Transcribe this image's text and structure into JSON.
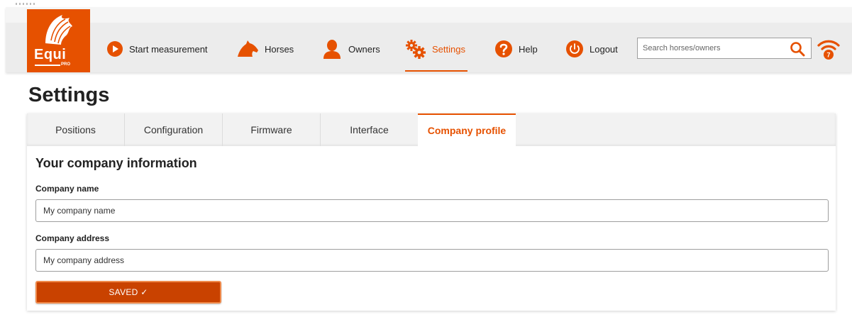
{
  "app": {
    "brand": "Equi",
    "brand_sub": "PRO",
    "accent": "#e65100"
  },
  "nav": {
    "items": [
      {
        "label": "Start measurement",
        "icon": "play-circle-icon"
      },
      {
        "label": "Horses",
        "icon": "horse-head-icon"
      },
      {
        "label": "Owners",
        "icon": "person-icon"
      },
      {
        "label": "Settings",
        "icon": "gears-icon",
        "active": true
      },
      {
        "label": "Help",
        "icon": "question-icon"
      },
      {
        "label": "Logout",
        "icon": "power-icon"
      }
    ],
    "search_placeholder": "Search horses/owners",
    "wifi_badge": "7"
  },
  "page": {
    "title": "Settings"
  },
  "tabs": [
    {
      "label": "Positions"
    },
    {
      "label": "Configuration"
    },
    {
      "label": "Firmware"
    },
    {
      "label": "Interface"
    },
    {
      "label": "Company profile",
      "active": true
    }
  ],
  "form": {
    "section_title": "Your company information",
    "company_name_label": "Company name",
    "company_name_value": "My company name",
    "company_address_label": "Company address",
    "company_address_value": "My company address",
    "save_label": "SAVED ✓"
  }
}
